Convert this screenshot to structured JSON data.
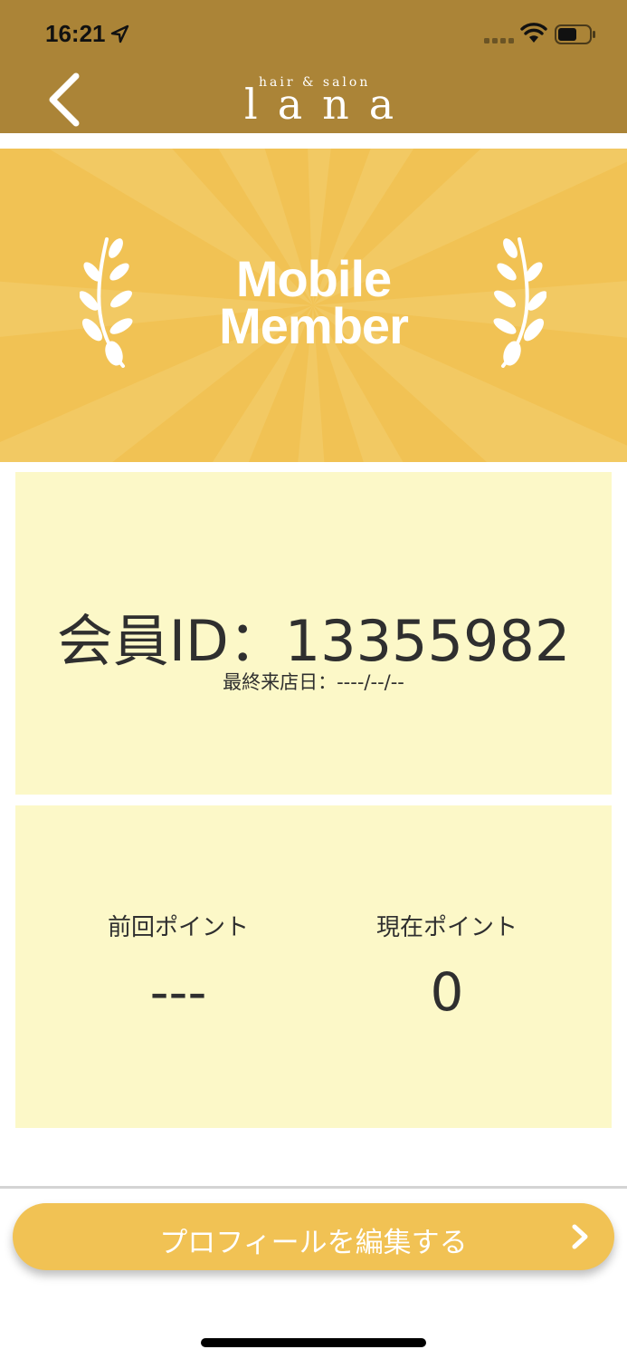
{
  "status_bar": {
    "time": "16:21"
  },
  "header": {
    "logo_small": "hair & salon",
    "logo_big": "lana"
  },
  "banner": {
    "title_line1": "Mobile",
    "title_line2": "Member"
  },
  "member": {
    "id_text": "会員ID：13355982",
    "last_visit": "最終来店日：----/--/--"
  },
  "points": {
    "previous_label": "前回ポイント",
    "previous_value": "---",
    "current_label": "現在ポイント",
    "current_value": "0"
  },
  "edit_profile": {
    "label": "プロフィールを編集する"
  },
  "colors": {
    "header_bg": "#ab8437",
    "banner_bg": "#f1c254",
    "card_bg": "#fcf8c8",
    "button_bg": "#f1c254"
  },
  "icons": [
    "location-arrow-icon",
    "signal-icon",
    "wifi-icon",
    "battery-icon",
    "back-chevron-icon",
    "laurel-icon",
    "chevron-right-icon"
  ]
}
